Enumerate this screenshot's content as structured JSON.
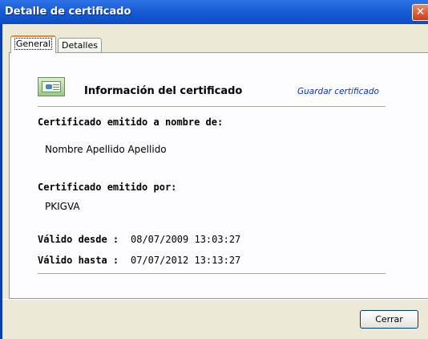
{
  "window": {
    "title": "Detalle de certificado",
    "close_glyph": "✕"
  },
  "tabs": [
    {
      "label": "General",
      "active": true
    },
    {
      "label": "Detalles",
      "active": false
    }
  ],
  "certificate": {
    "icon": "certificate-icon",
    "heading": "Información del certificado",
    "save_link": "Guardar certificado",
    "issued_to_label": "Certificado emitido a nombre de:",
    "issued_to_value": "Nombre Apellido Apellido",
    "issued_by_label": "Certificado emitido por:",
    "issued_by_value": "PKIGVA",
    "valid_from_label": "Válido desde :",
    "valid_from_value": "08/07/2009 13:03:27",
    "valid_to_label": "Válido hasta :",
    "valid_to_value": "07/07/2012 13:13:27"
  },
  "footer": {
    "close_button": "Cerrar"
  },
  "colors": {
    "titlebar": "#0a4cc4",
    "link": "#0033cc",
    "dialog_bg": "#ece9d8"
  }
}
